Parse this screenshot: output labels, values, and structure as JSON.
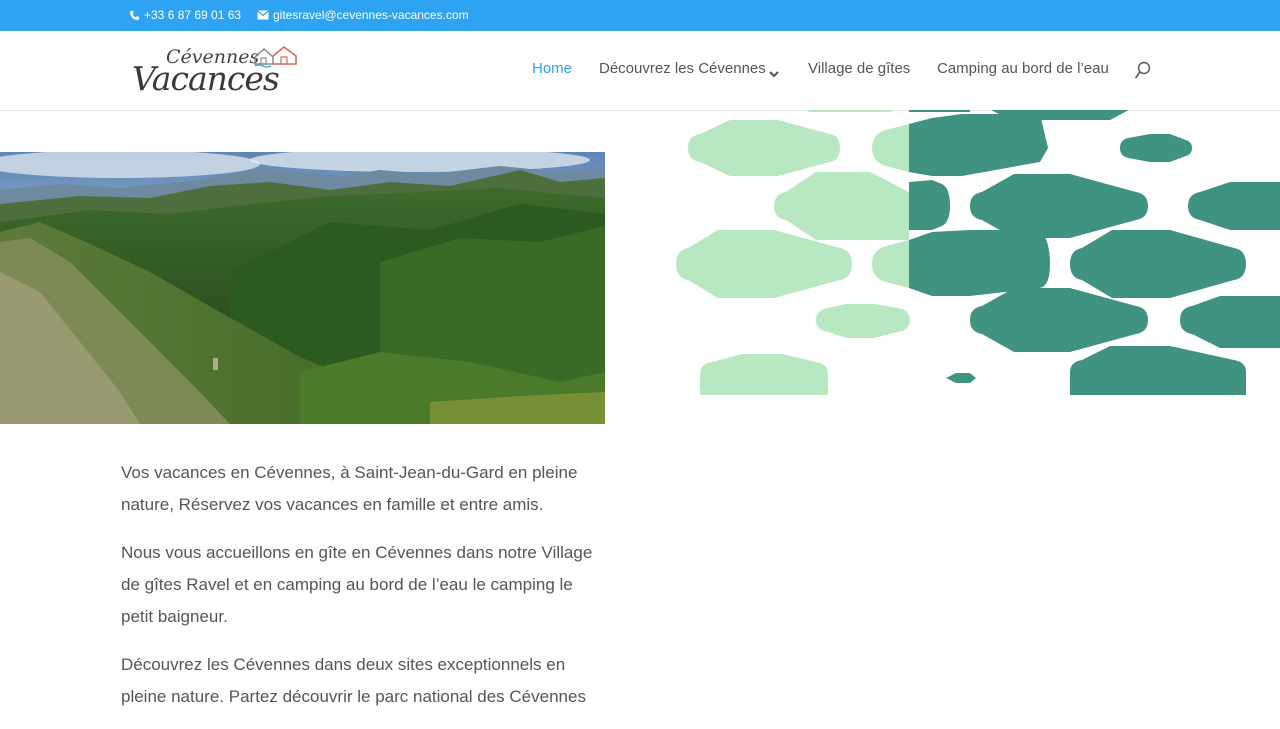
{
  "topbar": {
    "phone": "+33 6 87 69 01 63",
    "email": "gitesravel@cevennes-vacances.com",
    "icons": [
      "phone-icon",
      "mail-icon"
    ],
    "bg_color": "#2ea3f2"
  },
  "logo": {
    "line1": "Cévennes",
    "line2": "Vacances"
  },
  "nav": {
    "items": [
      {
        "label": "Home",
        "active": true
      },
      {
        "label": "Découvrez les Cévennes",
        "has_dropdown": true
      },
      {
        "label": "Village de gîtes"
      },
      {
        "label": "Camping au bord de l’eau"
      }
    ],
    "active_color": "#2ea3f2",
    "search_icon": "search-icon"
  },
  "hero": {
    "image": "mountain-landscape"
  },
  "decor": {
    "light_green": "#b7e8c1",
    "dark_green": "#3f9380"
  },
  "content": {
    "paragraphs": [
      "Vos vacances en Cévennes, à Saint-Jean-du-Gard en pleine nature, Réservez vos vacances  en famille et entre amis.",
      "Nous vous accueillons en gîte en Cévennes dans notre Village de gîtes Ravel et en camping au bord de l’eau le camping le petit baigneur.",
      "Découvrez les Cévennes dans deux sites exceptionnels en pleine nature. Partez découvrir le parc national des Cévennes"
    ]
  }
}
